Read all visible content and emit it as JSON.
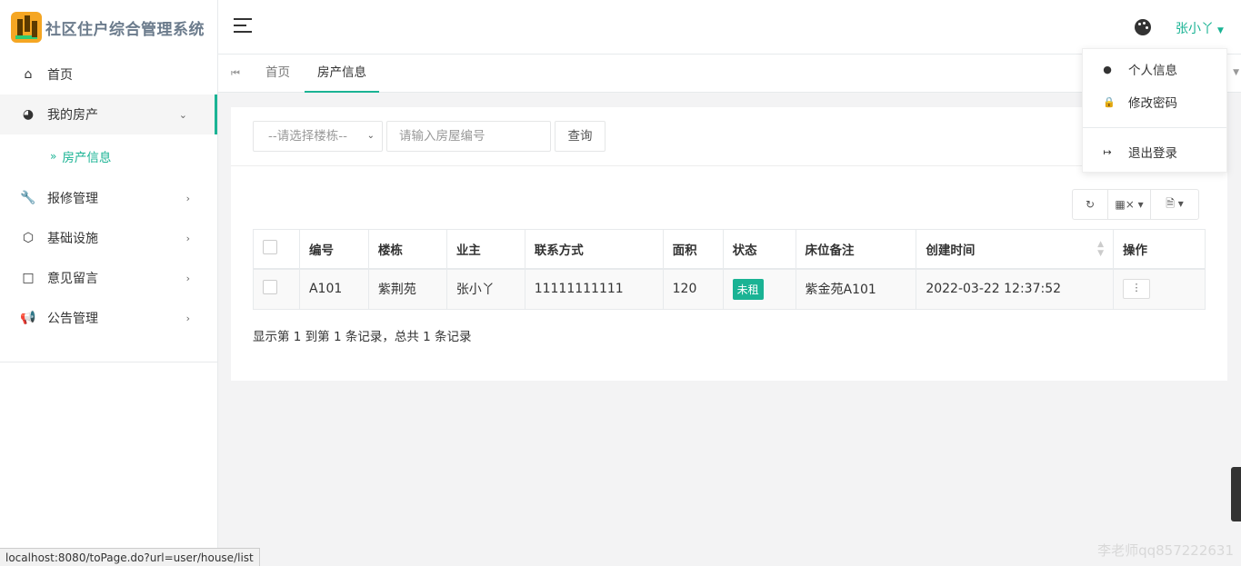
{
  "app": {
    "title": "社区住户综合管理系统"
  },
  "sidebar": {
    "items": [
      {
        "label": "首页",
        "icon": "home-icon"
      },
      {
        "label": "我的房产",
        "icon": "house-icon",
        "expanded": true,
        "sub": [
          {
            "label": "房产信息"
          }
        ]
      },
      {
        "label": "报修管理",
        "icon": "wrench-icon"
      },
      {
        "label": "基础设施",
        "icon": "cube-icon"
      },
      {
        "label": "意见留言",
        "icon": "comment-icon"
      },
      {
        "label": "公告管理",
        "icon": "bullhorn-icon"
      }
    ]
  },
  "header": {
    "user": "张小丫"
  },
  "tabs": [
    {
      "label": "首页"
    },
    {
      "label": "房产信息",
      "active": true
    }
  ],
  "search": {
    "building_select": "--请选择楼栋--",
    "house_placeholder": "请输入房屋编号",
    "query_label": "查询"
  },
  "table": {
    "headers": [
      "编号",
      "楼栋",
      "业主",
      "联系方式",
      "面积",
      "状态",
      "床位备注",
      "创建时间",
      "操作"
    ],
    "rows": [
      {
        "code": "A101",
        "building": "紫荆苑",
        "owner": "张小丫",
        "phone": "11111111111",
        "area": "120",
        "status": "未租",
        "bed_note": "紫金苑A101",
        "created": "2022-03-22 12:37:52"
      }
    ],
    "info": "显示第 1 到第 1 条记录，总共 1 条记录"
  },
  "user_menu": {
    "items": [
      {
        "label": "个人信息",
        "icon": "user-icon"
      },
      {
        "label": "修改密码",
        "icon": "lock-icon"
      },
      {
        "label": "退出登录",
        "icon": "logout-icon"
      }
    ]
  },
  "status_bar": {
    "url": "localhost:8080/toPage.do?url=user/house/list"
  },
  "watermark": "李老师qq857222631",
  "colors": {
    "accent": "#1ab394",
    "brand_title": "#6b7b8c"
  }
}
